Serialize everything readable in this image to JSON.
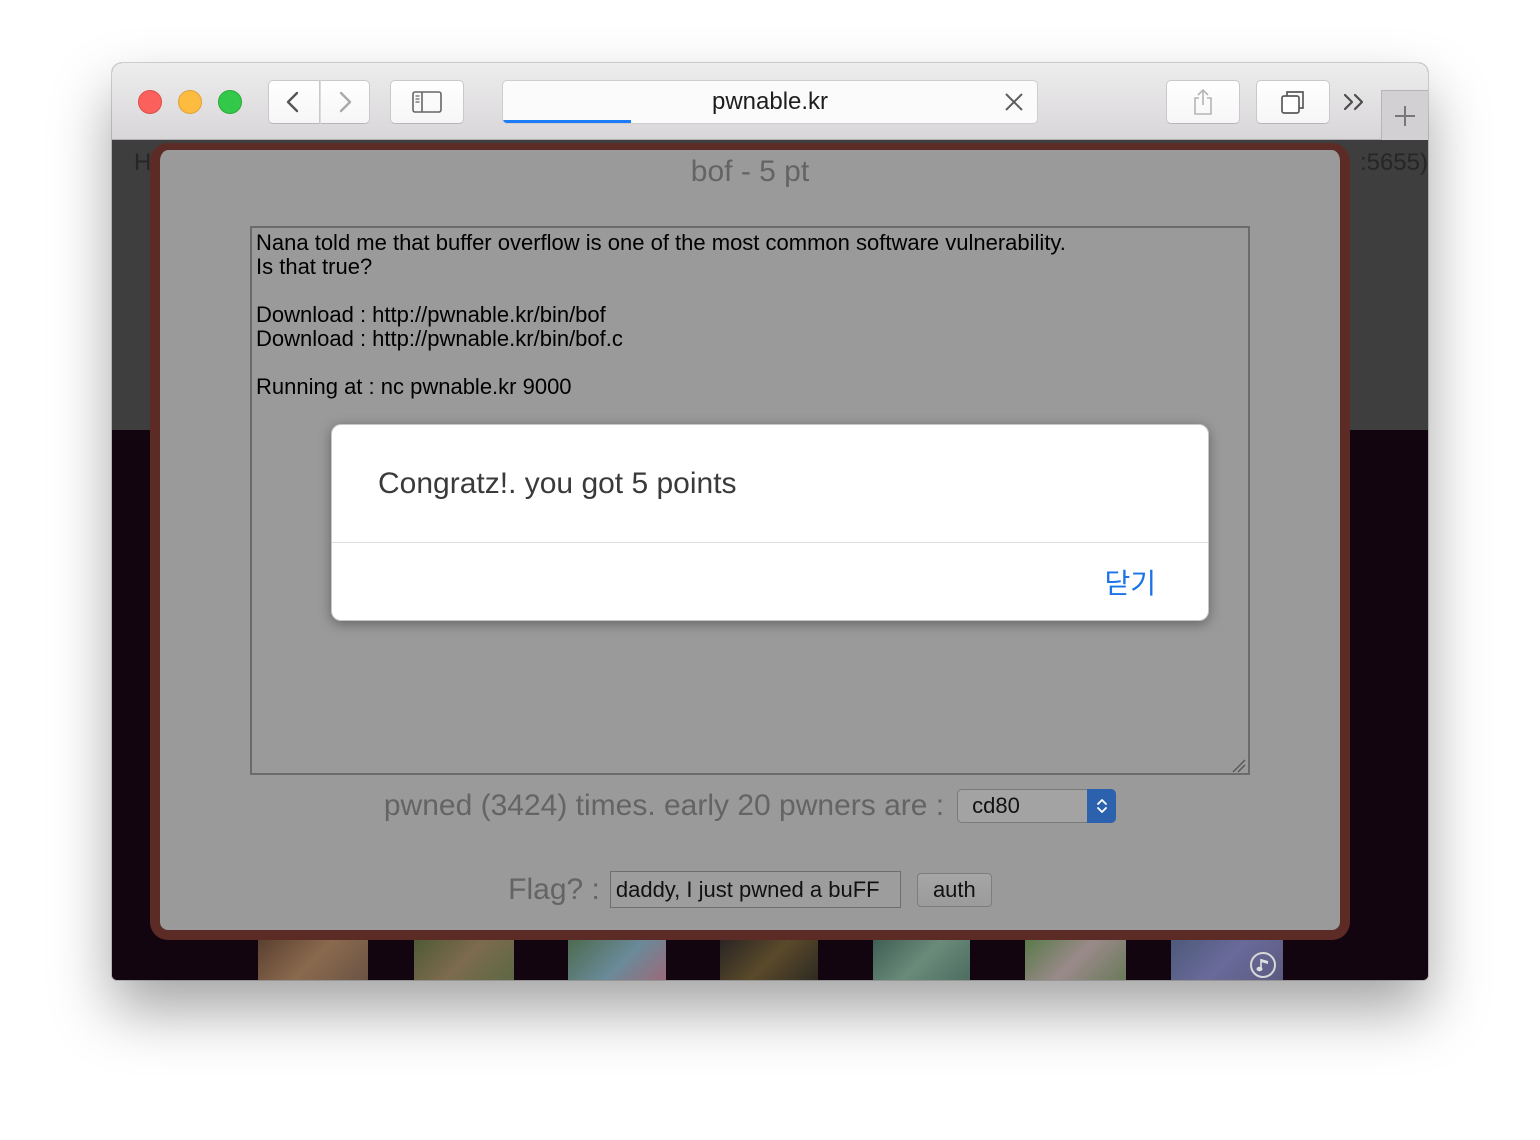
{
  "browser": {
    "address": "pwnable.kr",
    "load_progress": 0.24
  },
  "page": {
    "left_fragment": "H",
    "right_fragment": ":5655)"
  },
  "challenge": {
    "title": "bof - 5 pt",
    "description": "Nana told me that buffer overflow is one of the most common software vulnerability.\nIs that true?\n\nDownload : http://pwnable.kr/bin/bof\nDownload : http://pwnable.kr/bin/bof.c\n\nRunning at : nc pwnable.kr 9000",
    "pwned_text": "pwned (3424) times. early 20 pwners are :",
    "pwners_selected": "cd80",
    "flag_label": "Flag? :",
    "flag_value": "daddy, I just pwned a buFF",
    "auth_label": "auth"
  },
  "alert": {
    "message": "Congratz!. you got 5 points",
    "close_label": "닫기"
  },
  "icons": [
    "close-window-icon",
    "minimize-window-icon",
    "zoom-window-icon",
    "back-chevron-icon",
    "forward-chevron-icon",
    "sidebar-icon",
    "clear-url-icon",
    "share-icon",
    "tabs-overview-icon",
    "overflow-chevrons-icon",
    "plus-icon",
    "resize-grip-icon",
    "chevron-updown-icon",
    "music-note-icon"
  ],
  "colors": {
    "accent": "#1a73e8",
    "progress": "#1b7cf6",
    "modal_border": "#5d2b26",
    "stepper": "#2c62ad"
  }
}
